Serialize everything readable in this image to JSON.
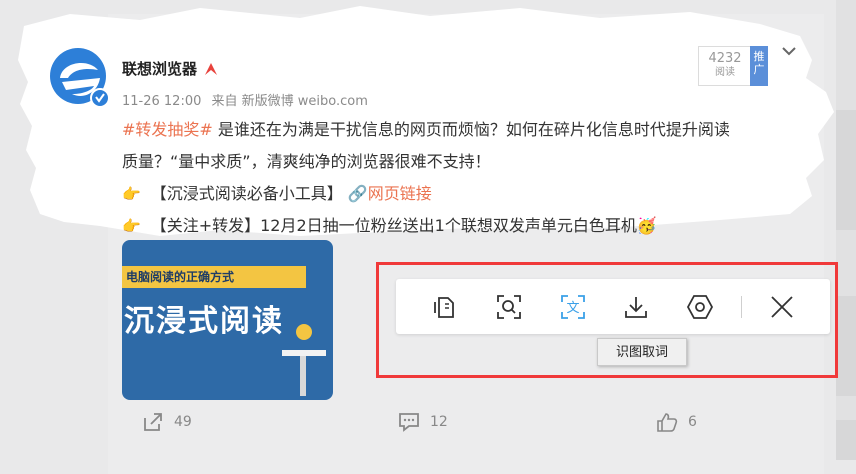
{
  "post": {
    "username": "联想浏览器",
    "time": "11-26 12:00",
    "source": "来自 新版微博 weibo.com",
    "views_count": "4232",
    "views_label": "阅读",
    "promo_label": "推广",
    "hashtag": "#转发抽奖#",
    "text_line1": " 是谁还在为满是干扰信息的网页而烦恼？如何在碎片化信息时代提升阅读",
    "text_line2": "质量？“量中求质”，清爽纯净的浏览器很难不支持！",
    "bullet1_text": "【沉浸式阅读必备小工具】",
    "bullet1_link": "网页链接",
    "bullet2_text": "【关注+转发】12月2日抽一位粉丝送出1个联想双发声单元白色耳机",
    "thumb_band": "电脑阅读的正确方式",
    "thumb_title": "沉浸式阅读"
  },
  "actions": {
    "share_count": "49",
    "comment_count": "12",
    "like_count": "6"
  },
  "toolbar": {
    "buttons": [
      "copy-icon",
      "screenshot-scan-icon",
      "ocr-text-icon",
      "download-icon",
      "settings-hexagon-icon",
      "close-icon"
    ],
    "tooltip": "识图取词"
  },
  "colors": {
    "accent_orange": "#eb7350",
    "highlight_red": "#f0393a",
    "ocr_blue": "#3aa0e8"
  }
}
